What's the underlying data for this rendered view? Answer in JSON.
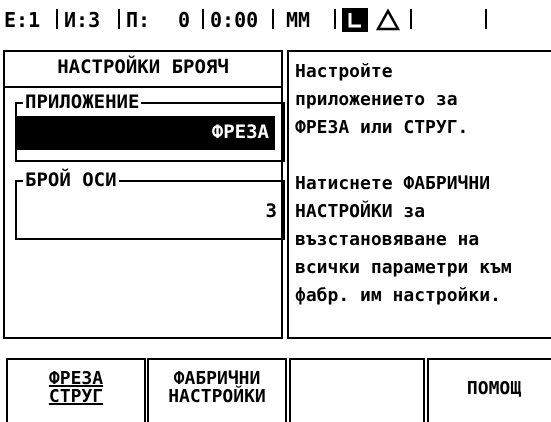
{
  "status_bar": {
    "e": "Е:1",
    "i": "И:3",
    "p": "П:",
    "p_value": "0",
    "time": "0:00",
    "units": "ММ"
  },
  "setup_panel": {
    "title": "НАСТРОЙКИ БРОЯЧ",
    "application_label": "ПРИЛОЖЕНИЕ",
    "application_value": "ФРЕЗА",
    "axes_label": "БРОЙ ОСИ",
    "axes_value": "3"
  },
  "help_text": "Настройте\nприложението за\nФРЕЗА или СТРУГ.\n\nНатиснете ФАБРИЧНИ\nНАСТРОЙКИ за\nвъзстановяване на\nвсички параметри към\nфабр. им настройки.",
  "softkeys": {
    "mill_lathe": {
      "line1": "ФРЕЗА",
      "line2": "СТРУГ"
    },
    "factory_settings": {
      "line1": "ФАБРИЧНИ",
      "line2": "НАСТРОЙКИ"
    },
    "empty": "",
    "help": "ПОМОЩ"
  },
  "icons": [
    "reference-icon",
    "delta-icon"
  ],
  "colors": {
    "background": "#ffffff",
    "foreground": "#000000"
  }
}
